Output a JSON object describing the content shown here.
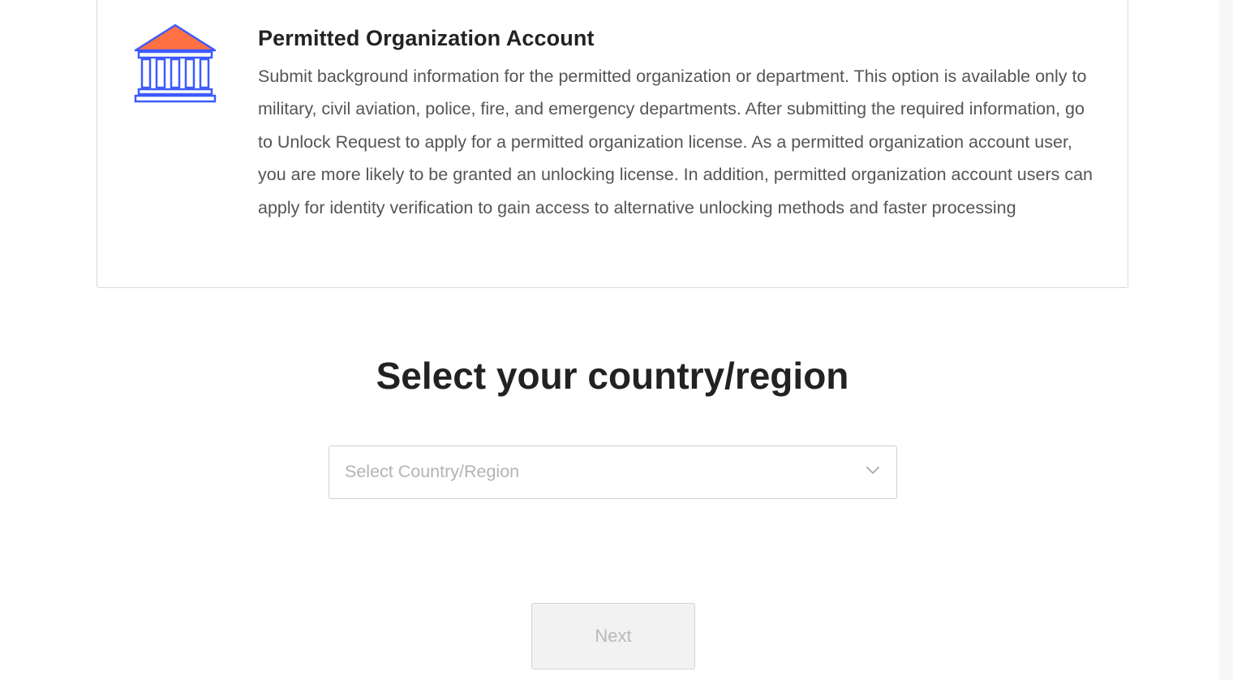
{
  "account_option": {
    "title": "Permitted Organization Account",
    "description": "Submit background information for the permitted organization or department. This option is available only to military, civil aviation, police, fire, and emergency departments. After submitting the required information, go to Unlock Request to apply for a permitted organization license. As a permitted organization account user, you are more likely to be granted an unlocking license. In addition, permitted organization account users can apply for identity verification to gain access to alternative unlocking methods and faster processing",
    "icon": "government-building-icon",
    "icon_colors": {
      "roof": "#ff7043",
      "outline": "#3d5afe"
    }
  },
  "country_section": {
    "title": "Select your country/region",
    "select": {
      "placeholder": "Select Country/Region",
      "value": ""
    }
  },
  "actions": {
    "next_label": "Next",
    "next_disabled": true
  }
}
